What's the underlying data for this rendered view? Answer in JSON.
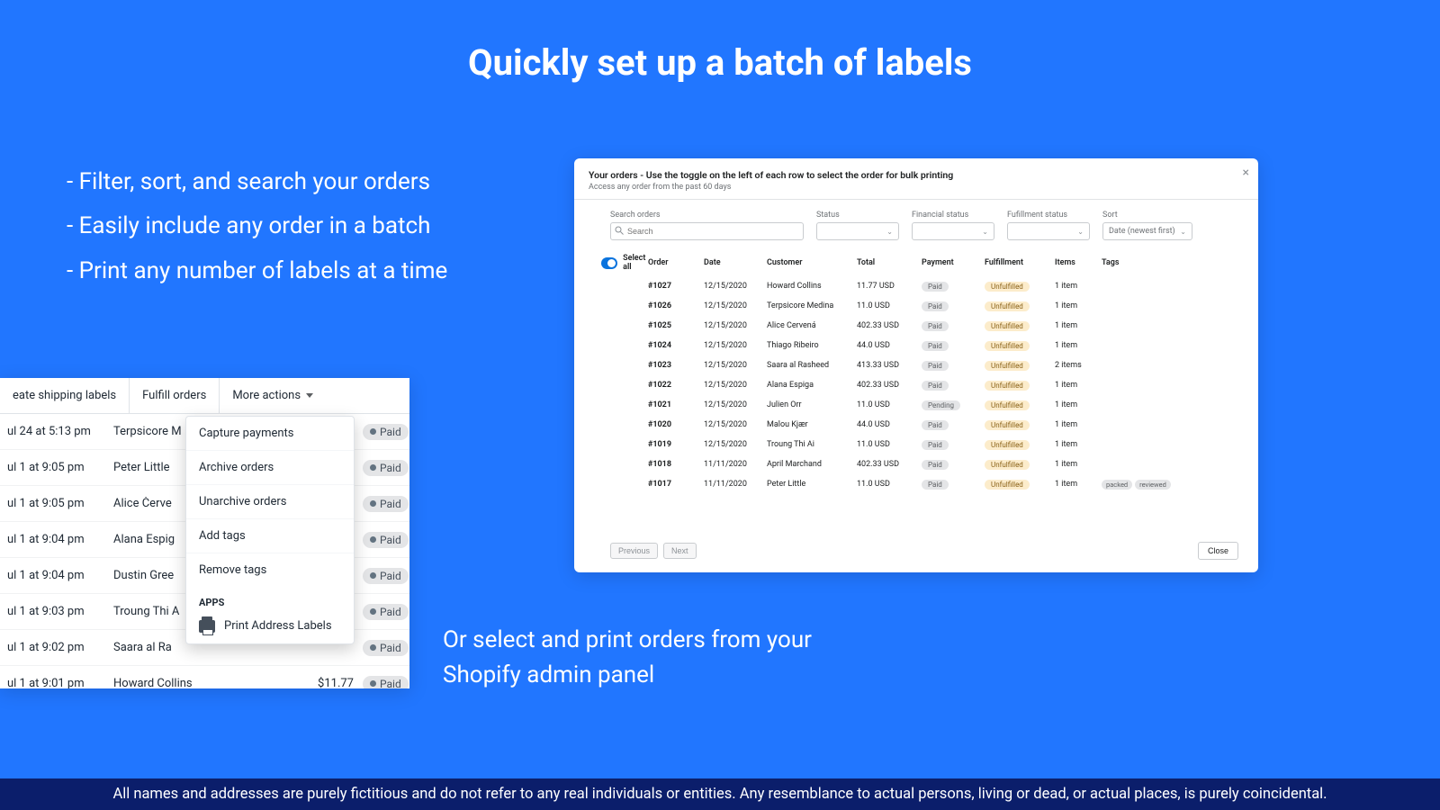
{
  "headline": "Quickly set up a batch of labels",
  "bullets": [
    "- Filter, sort, and search your orders",
    "- Easily include any order in a batch",
    "- Print any number of labels at a time"
  ],
  "orders_panel": {
    "title": "Your orders - Use the toggle on the left of each row to select the order for bulk printing",
    "subtitle": "Access any order from the past 60 days",
    "close_x": "×",
    "filters": {
      "search_label": "Search orders",
      "search_placeholder": "Search",
      "status_label": "Status",
      "financial_label": "Financial status",
      "fulfillment_label": "Fufillment status",
      "sort_label": "Sort",
      "sort_value": "Date (newest first)"
    },
    "select_all_label": "Select all",
    "columns": [
      "Order",
      "Date",
      "Customer",
      "Total",
      "Payment",
      "Fulfillment",
      "Items",
      "Tags"
    ],
    "rows": [
      {
        "order": "#1027",
        "date": "12/15/2020",
        "customer": "Howard Collins",
        "total": "11.77 USD",
        "payment": "Paid",
        "fulfillment": "Unfulfilled",
        "items": "1 item",
        "tags": []
      },
      {
        "order": "#1026",
        "date": "12/15/2020",
        "customer": "Terpsicore Medina",
        "total": "11.0 USD",
        "payment": "Paid",
        "fulfillment": "Unfulfilled",
        "items": "1 item",
        "tags": []
      },
      {
        "order": "#1025",
        "date": "12/15/2020",
        "customer": "Alice Červená",
        "total": "402.33 USD",
        "payment": "Paid",
        "fulfillment": "Unfulfilled",
        "items": "1 item",
        "tags": []
      },
      {
        "order": "#1024",
        "date": "12/15/2020",
        "customer": "Thiago Ribeiro",
        "total": "44.0 USD",
        "payment": "Paid",
        "fulfillment": "Unfulfilled",
        "items": "1 item",
        "tags": []
      },
      {
        "order": "#1023",
        "date": "12/15/2020",
        "customer": "Saara al Rasheed",
        "total": "413.33 USD",
        "payment": "Paid",
        "fulfillment": "Unfulfilled",
        "items": "2 items",
        "tags": []
      },
      {
        "order": "#1022",
        "date": "12/15/2020",
        "customer": "Alana Espiga",
        "total": "402.33 USD",
        "payment": "Paid",
        "fulfillment": "Unfulfilled",
        "items": "1 item",
        "tags": []
      },
      {
        "order": "#1021",
        "date": "12/15/2020",
        "customer": "Julien Orr",
        "total": "11.0 USD",
        "payment": "Pending",
        "fulfillment": "Unfulfilled",
        "items": "1 item",
        "tags": []
      },
      {
        "order": "#1020",
        "date": "12/15/2020",
        "customer": "Malou Kjær",
        "total": "44.0 USD",
        "payment": "Paid",
        "fulfillment": "Unfulfilled",
        "items": "1 item",
        "tags": []
      },
      {
        "order": "#1019",
        "date": "12/15/2020",
        "customer": "Troung Thi Ai",
        "total": "11.0 USD",
        "payment": "Paid",
        "fulfillment": "Unfulfilled",
        "items": "1 item",
        "tags": []
      },
      {
        "order": "#1018",
        "date": "11/11/2020",
        "customer": "April Marchand",
        "total": "402.33 USD",
        "payment": "Paid",
        "fulfillment": "Unfulfilled",
        "items": "1 item",
        "tags": []
      },
      {
        "order": "#1017",
        "date": "11/11/2020",
        "customer": "Peter Little",
        "total": "11.0 USD",
        "payment": "Paid",
        "fulfillment": "Unfulfilled",
        "items": "1 item",
        "tags": [
          "packed",
          "reviewed"
        ]
      }
    ],
    "prev_label": "Previous",
    "next_label": "Next",
    "close_label": "Close"
  },
  "admin_fragment": {
    "toolbar": {
      "create_labels": "eate shipping labels",
      "fulfill": "Fulfill orders",
      "more": "More actions"
    },
    "rows": [
      {
        "time": "ul 24 at 5:13 pm",
        "name": "Terpsicore M",
        "paid": "Paid"
      },
      {
        "time": "ul 1 at 9:05 pm",
        "name": "Peter Little",
        "paid": "Paid"
      },
      {
        "time": "ul 1 at 9:05 pm",
        "name": "Alice Červe",
        "paid": "Paid"
      },
      {
        "time": "ul 1 at 9:04 pm",
        "name": "Alana Espig",
        "paid": "Paid"
      },
      {
        "time": "ul 1 at 9:04 pm",
        "name": "Dustin Gree",
        "paid": "Paid"
      },
      {
        "time": "ul 1 at 9:03 pm",
        "name": "Troung Thi A",
        "paid": "Paid"
      },
      {
        "time": "ul 1 at 9:02 pm",
        "name": "Saara al Ra",
        "paid": "Paid"
      },
      {
        "time": "ul 1 at 9:01 pm",
        "name": "Howard Collins",
        "amount": "$11.77",
        "paid": "Paid"
      }
    ],
    "menu": {
      "capture": "Capture payments",
      "archive": "Archive orders",
      "unarchive": "Unarchive orders",
      "add_tags": "Add tags",
      "remove_tags": "Remove tags",
      "apps_section": "APPS",
      "print_labels": "Print Address Labels"
    }
  },
  "sub_caption_1": "Or select and print orders from your",
  "sub_caption_2": "Shopify admin panel",
  "disclaimer": "All names and addresses are purely fictitious and do not refer to any real individuals or entities. Any resemblance to actual persons, living or dead, or actual places, is purely coincidental."
}
